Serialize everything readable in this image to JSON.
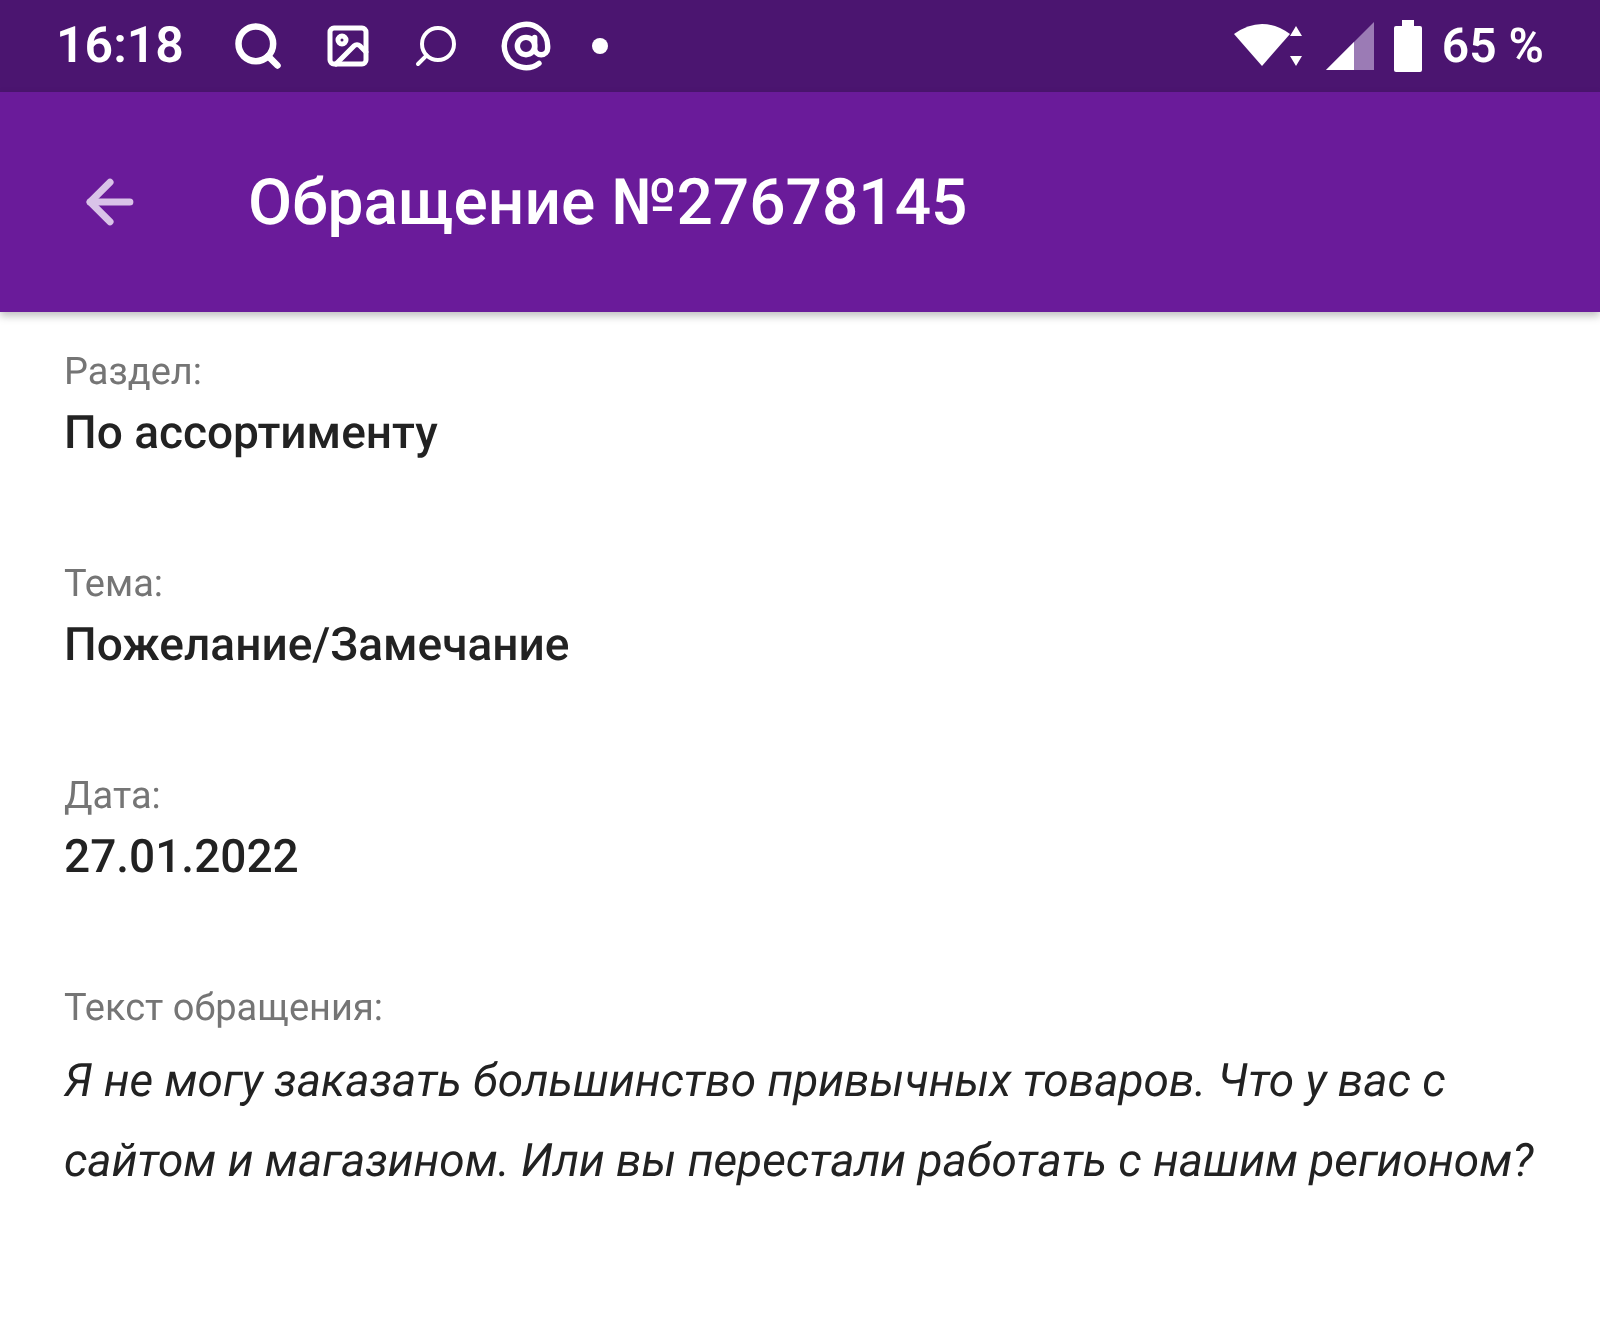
{
  "status_bar": {
    "time": "16:18",
    "battery": "65 %"
  },
  "app_bar": {
    "title": "Обращение №27678145"
  },
  "fields": [
    {
      "label": "Раздел:",
      "value": "По ассортименту",
      "kind": "short"
    },
    {
      "label": "Тема:",
      "value": "Пожелание/Замечание",
      "kind": "short"
    },
    {
      "label": "Дата:",
      "value": "27.01.2022",
      "kind": "short"
    },
    {
      "label": "Текст обращения:",
      "value": "Я не могу заказать большинство привычных товаров. Что у вас с сайтом и магазином. Или вы перестали работать с нашим регионом?",
      "kind": "long"
    }
  ]
}
